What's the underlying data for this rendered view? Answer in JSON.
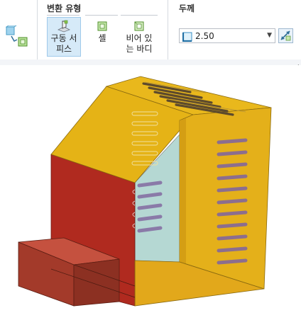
{
  "ribbon": {
    "main_icon": "transform-shell-icon",
    "transform_type": {
      "title": "변환 유형",
      "buttons": [
        {
          "label": "구동 서\n피스",
          "icon": "driving-surface-icon",
          "active": true
        },
        {
          "label": "셸",
          "icon": "shell-icon",
          "active": false
        },
        {
          "label": "비어 있\n는 바디",
          "icon": "hollow-body-icon",
          "active": false
        }
      ]
    },
    "thickness": {
      "title": "두께",
      "value": "2.50",
      "icon": "thickness-icon",
      "dropdown_icon": "dropdown-arrow-icon",
      "flip_icon": "flip-direction-icon"
    }
  },
  "colors": {
    "accent_active": "#d6eaf8",
    "housing_yellow": "#e5b316",
    "housing_red": "#b3261e",
    "glass": "#b7d7d3",
    "slot": "#8c6e8e",
    "block": "#a33a2a"
  }
}
